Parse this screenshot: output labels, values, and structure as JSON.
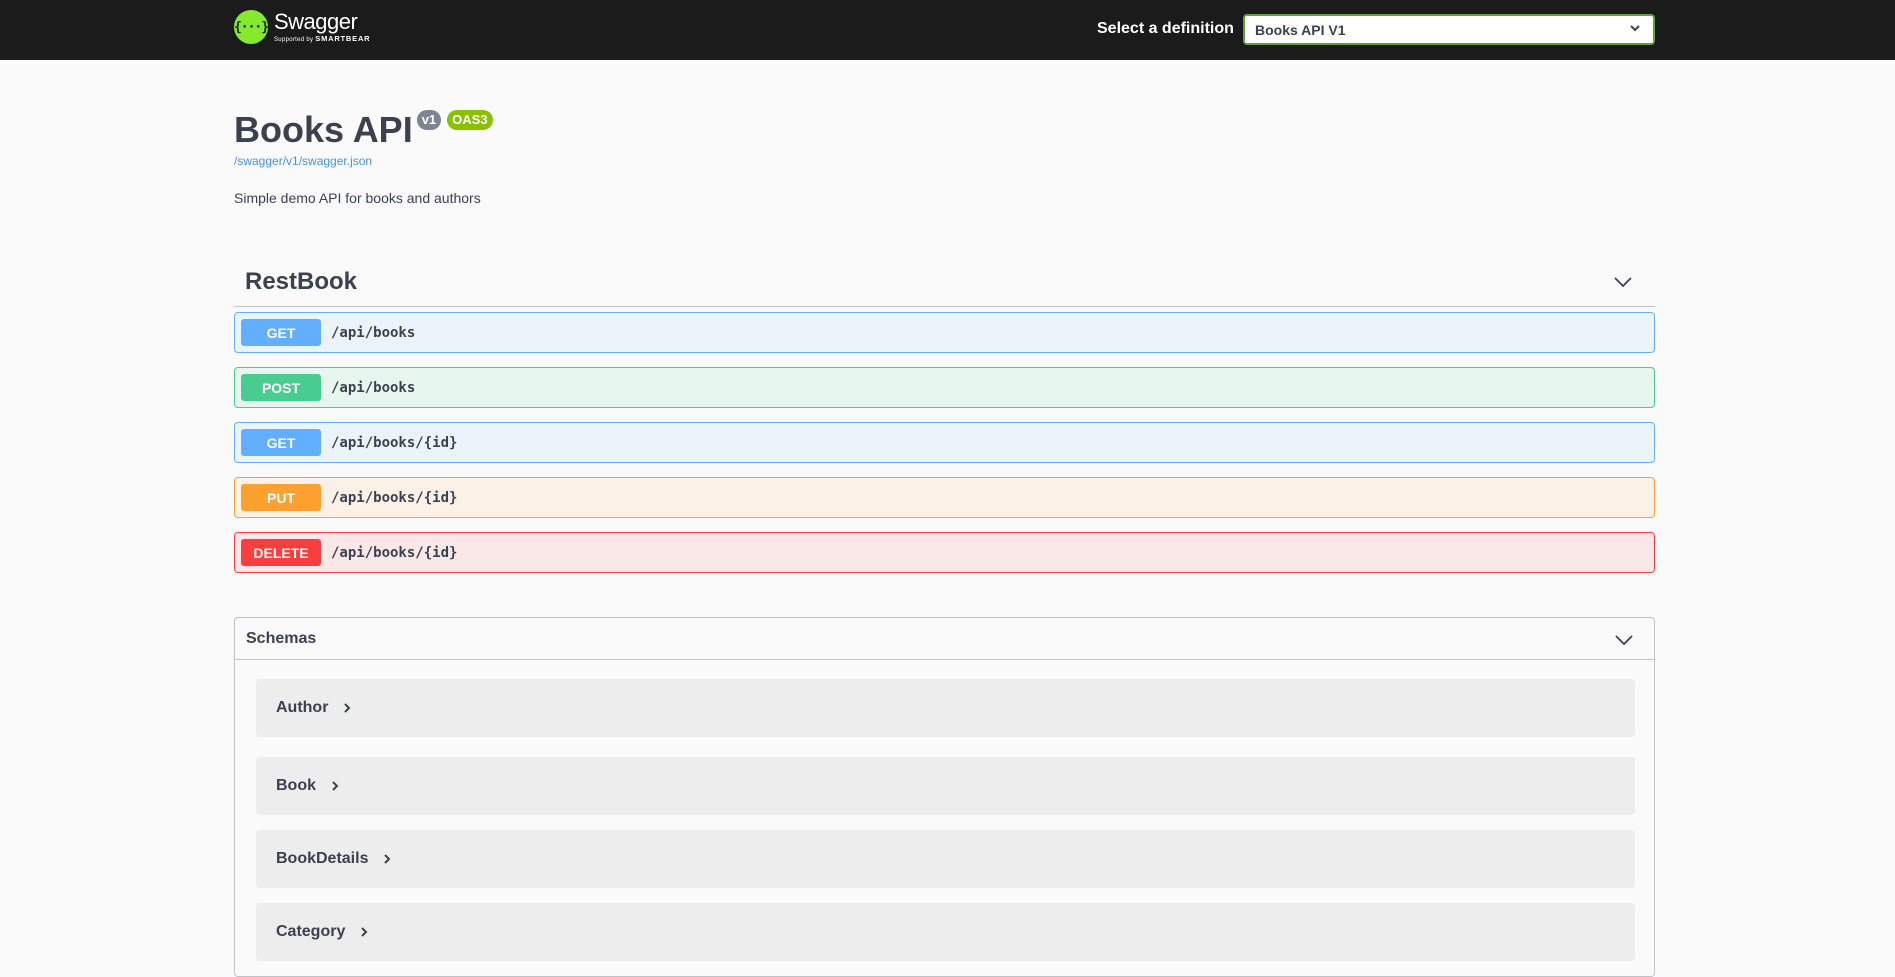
{
  "topbar": {
    "logo_title": "Swagger",
    "logo_sub_prefix": "Supported by",
    "logo_sub_brand": "SMARTBEAR",
    "logo_icon": "swagger-braces-icon",
    "definition_label": "Select a definition",
    "definition_selected": "Books API V1"
  },
  "info": {
    "title": "Books API",
    "version_badge": "v1",
    "oas_badge": "OAS3",
    "spec_link": "/swagger/v1/swagger.json",
    "description": "Simple demo API for books and authors"
  },
  "tag": {
    "name": "RestBook",
    "operations": [
      {
        "method": "GET",
        "path": "/api/books"
      },
      {
        "method": "POST",
        "path": "/api/books"
      },
      {
        "method": "GET",
        "path": "/api/books/{id}"
      },
      {
        "method": "PUT",
        "path": "/api/books/{id}"
      },
      {
        "method": "DELETE",
        "path": "/api/books/{id}"
      }
    ]
  },
  "schemas": {
    "title": "Schemas",
    "models": [
      "Author",
      "Book",
      "BookDetails",
      "Category"
    ]
  },
  "colors": {
    "get": "#61affe",
    "post": "#49cc90",
    "put": "#fca130",
    "delete": "#f93e3e",
    "brand": "#85ea2d"
  }
}
